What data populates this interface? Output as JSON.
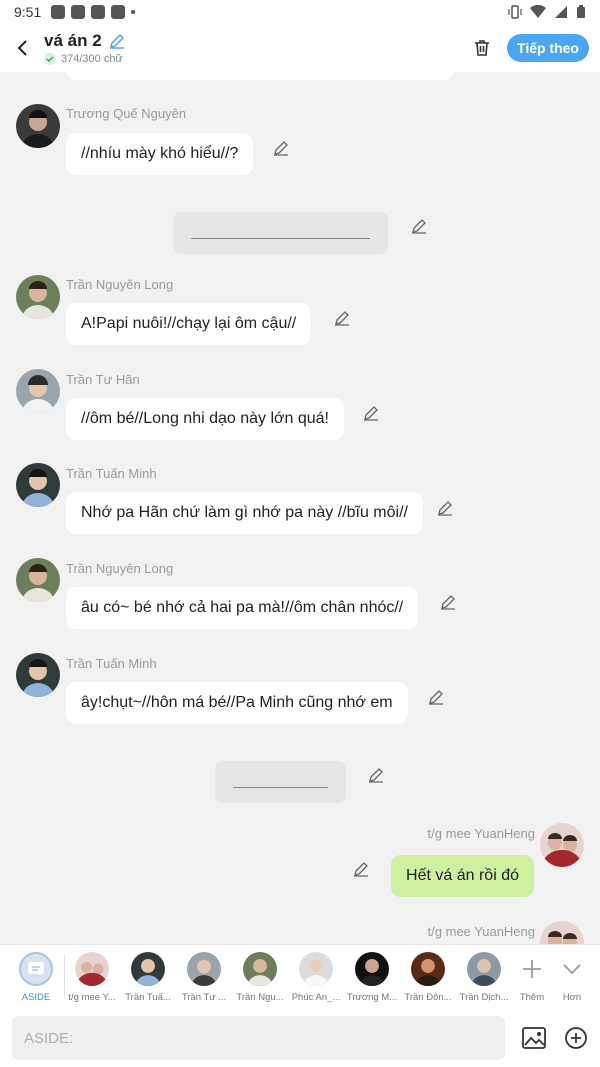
{
  "status_bar": {
    "time": "9:51"
  },
  "header": {
    "title": "vá án 2",
    "word_count": "374/300 chữ",
    "next_label": "Tiếp theo"
  },
  "messages": [
    {
      "name": "Trương Quế Nguyên",
      "text": "//nhíu mày khó hiểu//?"
    },
    {
      "name": "Trần Nguyên Long",
      "text": "A!Papi nuôi!//chạy lại ôm cậu//"
    },
    {
      "name": "Trần Tư Hãn",
      "text": "//ôm bé//Long nhi dạo này lớn quá!"
    },
    {
      "name": "Trần Tuấn Minh",
      "text": "Nhớ pa Hãn chứ làm gì nhớ pa này //bĩu môi//"
    },
    {
      "name": "Trần Nguyên Long",
      "text": "âu có~ bé nhớ cả hai pa mà!//ôm chân nhóc//"
    },
    {
      "name": "Trần Tuấn Minh",
      "text": "ây!chụt~//hôn má bé//Pa Minh cũng nhớ em"
    },
    {
      "name": "t/g mee YuanHeng",
      "text": "Hết vá án rồi đó"
    },
    {
      "name": "t/g mee YuanHeng",
      "text": ""
    }
  ],
  "char_bar": {
    "items": [
      {
        "label": "ASIDE"
      },
      {
        "label": "t/g mee Y..."
      },
      {
        "label": "Trần Tuấ..."
      },
      {
        "label": "Trần Tư ..."
      },
      {
        "label": "Trần Ngu..."
      },
      {
        "label": "Phúc An_..."
      },
      {
        "label": "Trương M..."
      },
      {
        "label": "Trần Đôn..."
      },
      {
        "label": "Trần Dịch..."
      },
      {
        "label": "Thêm"
      },
      {
        "label": "Hơn"
      }
    ]
  },
  "input": {
    "placeholder": "ASIDE:"
  },
  "colors": {
    "accent": "#4aa6f2",
    "own_bubble": "#cfefa1",
    "background": "#f2f2f2"
  }
}
